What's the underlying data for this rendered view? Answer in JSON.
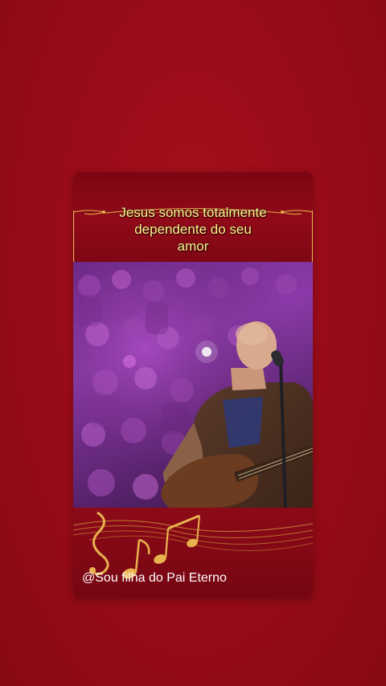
{
  "caption": {
    "lines": [
      "Jesus somos totalmente",
      "dependente do seu",
      "amor"
    ]
  },
  "watermark": {
    "text": "@Sou filha do Pai Eterno"
  },
  "colors": {
    "background": "#9a0c18",
    "caption_text": "#fbf58e",
    "ornament_gold": "#e2b24a",
    "watermark_text": "#ffffff"
  },
  "icons": {
    "decoration": "music-notes-icon"
  }
}
